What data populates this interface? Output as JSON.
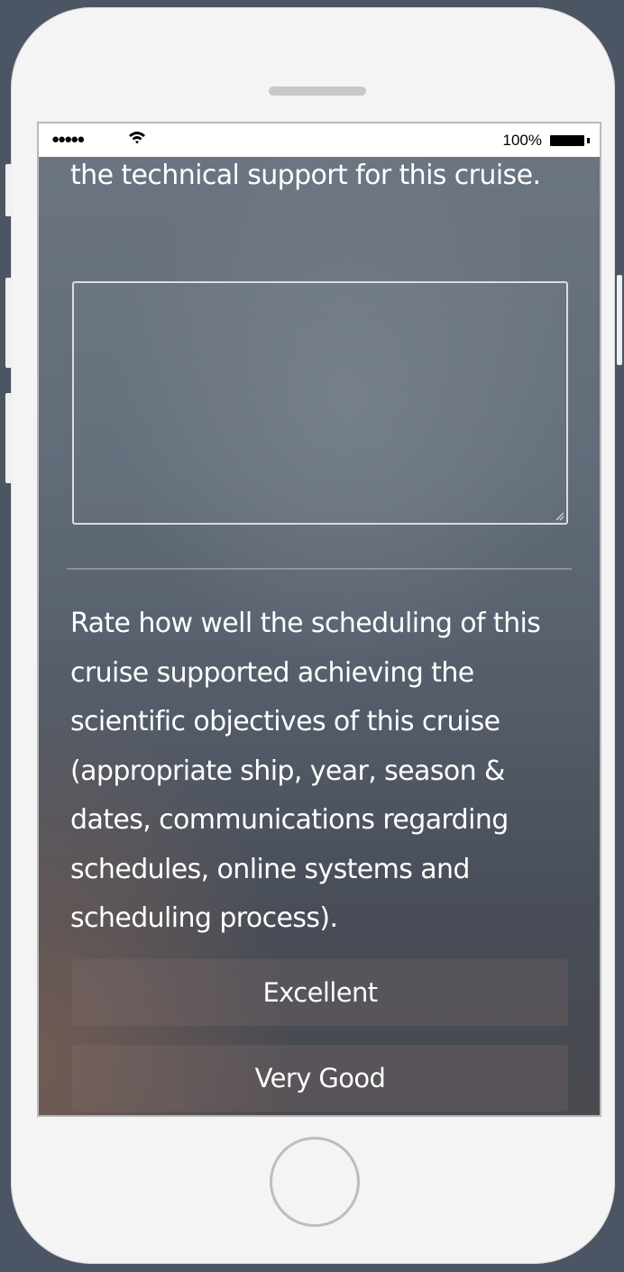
{
  "status_bar": {
    "signal": "●●●●●",
    "battery_percent": "100%"
  },
  "content": {
    "previous_question_tail": "the technical support for this cruise.",
    "comment_box": {
      "value": "",
      "placeholder": ""
    },
    "question": "Rate how well the scheduling of this cruise supported achieving the scientific objectives of this cruise (appropriate ship, year, season & dates, communications regarding schedules, online systems and scheduling process).",
    "options": [
      "Excellent",
      "Very Good"
    ]
  },
  "icons": {
    "wifi": "wifi-icon",
    "battery": "battery-icon",
    "home": "home-button-icon"
  }
}
